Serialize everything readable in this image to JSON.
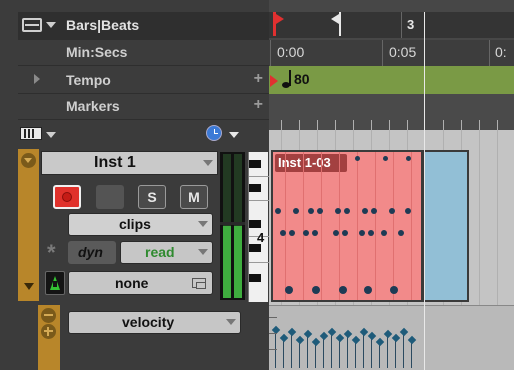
{
  "rulers": {
    "bars_beats": "Bars|Beats",
    "min_secs": "Min:Secs",
    "tempo": "Tempo",
    "markers": "Markers",
    "bar_number": "3",
    "time_0": "0:00",
    "time_5": "0:05",
    "time_10": "0:",
    "tempo_value": "80"
  },
  "track": {
    "name": "Inst 1",
    "solo": "S",
    "mute": "M",
    "view_mode": "clips",
    "dyn": "dyn",
    "automation": "read",
    "group": "none",
    "lane_param": "velocity"
  },
  "clip": {
    "name": "Inst 1-03",
    "color": "#f28a8a",
    "next_clip_color": "#92bfd6"
  },
  "keyboard": {
    "octave_label": "4"
  },
  "colors": {
    "tempo_bar": "#7a9a45",
    "record": "#e0312b",
    "meter": "#3fae3f",
    "track_color": "#b8862a"
  }
}
